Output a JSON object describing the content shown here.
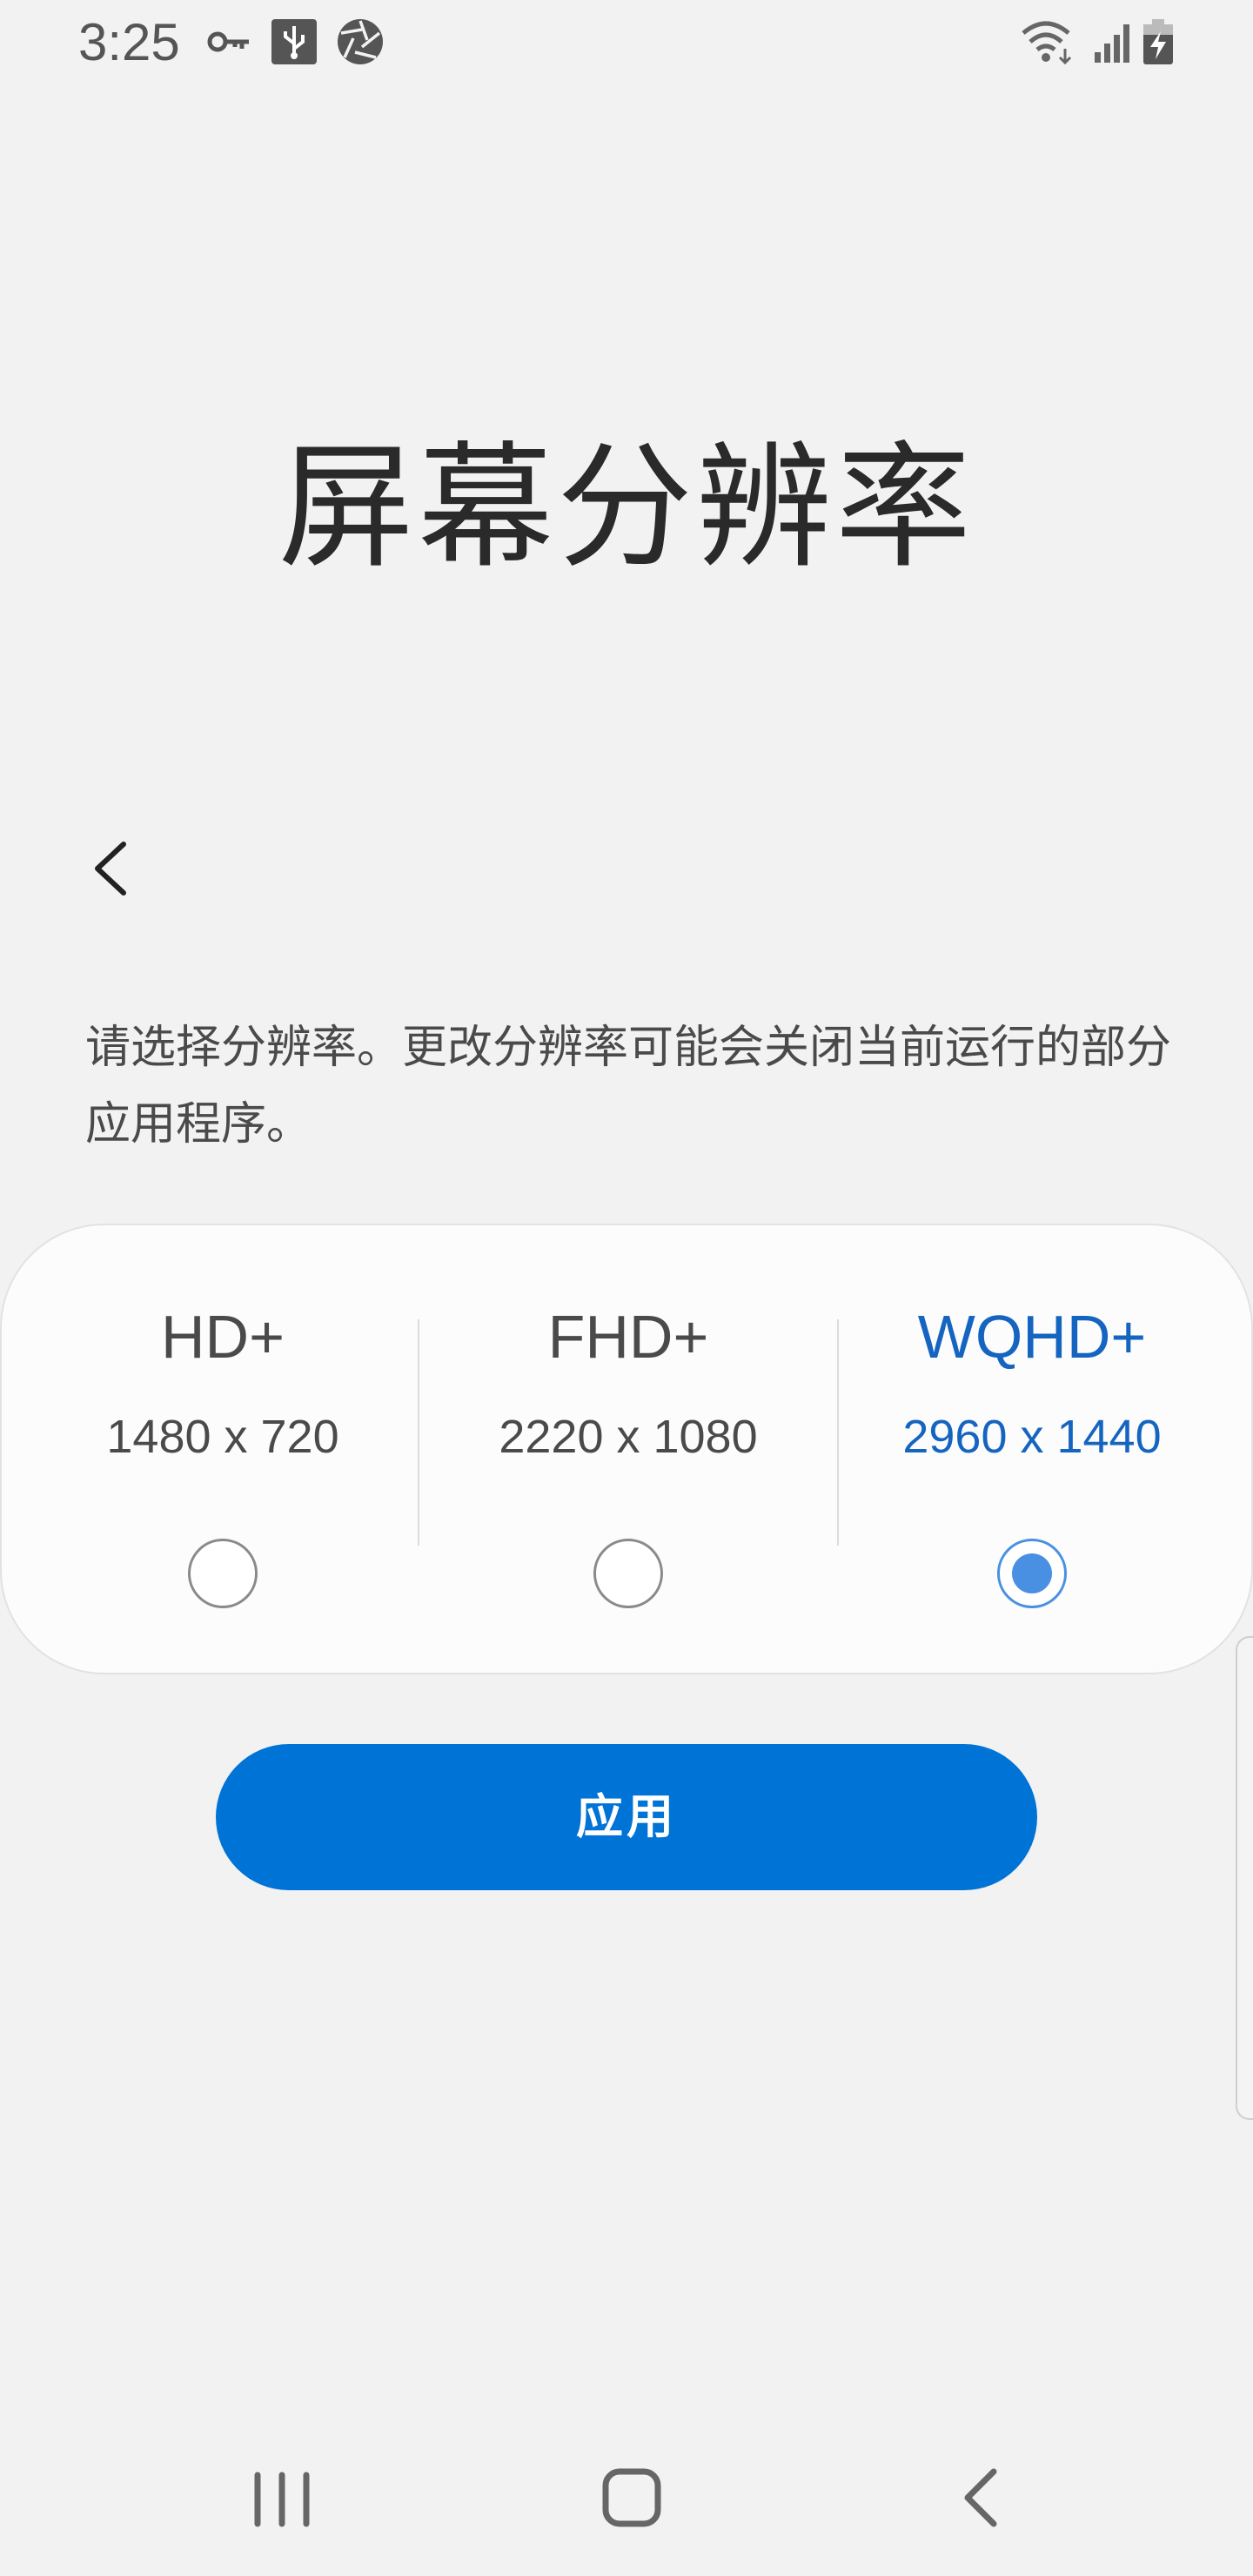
{
  "status_bar": {
    "time": "3:25",
    "icons": [
      "key-icon",
      "usb-icon",
      "aperture-icon",
      "wifi-icon",
      "signal-icon",
      "battery-charging-icon"
    ]
  },
  "title": "屏幕分辨率",
  "description": "请选择分辨率。更改分辨率可能会关闭当前运行的部分应用程序。",
  "options": [
    {
      "name": "HD+",
      "size": "1480 x 720",
      "selected": false
    },
    {
      "name": "FHD+",
      "size": "2220 x 1080",
      "selected": false
    },
    {
      "name": "WQHD+",
      "size": "2960 x 1440",
      "selected": true
    }
  ],
  "apply_label": "应用",
  "colors": {
    "accent": "#0073d6",
    "selected_text": "#1565c0",
    "radio_selected": "#4a90e2",
    "background": "#f2f2f2"
  },
  "nav_bar": [
    "recents-icon",
    "home-icon",
    "back-icon"
  ]
}
